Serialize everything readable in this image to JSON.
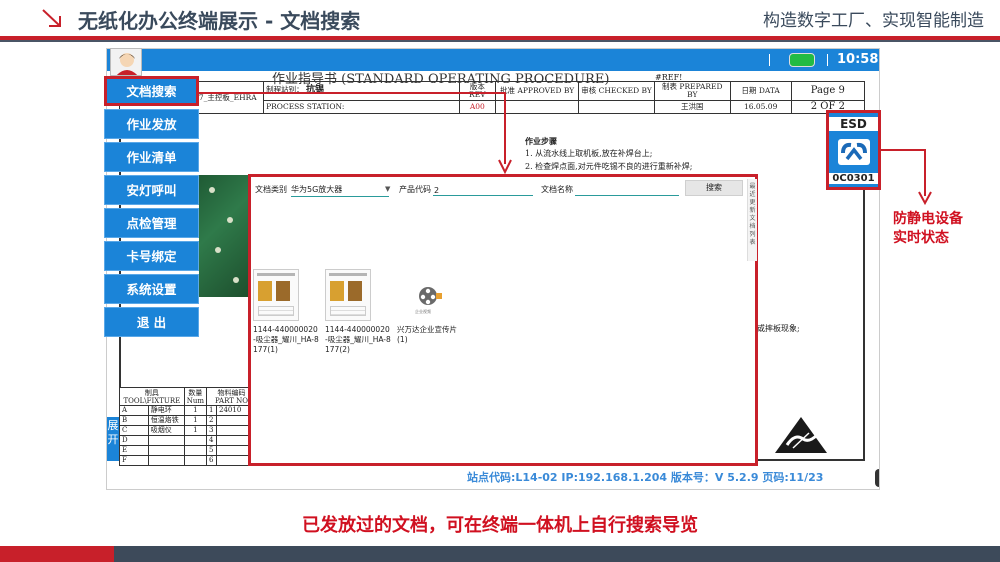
{
  "header": {
    "title": "无纸化办公终端展示 - 文档搜索",
    "slogan": "构造数字工厂、实现智能制造"
  },
  "topbar": {
    "time": "10:58"
  },
  "sop": {
    "title": "作业指导书 (STANDARD OPERATING PROCEDURE)",
    "ref": "#REF!",
    "product_cell": "吸尘器_耀川 HA-8177_主控板_EHRA",
    "process_station_label": "制程站别：",
    "process_station_value": "抗锡",
    "process_station_en": "PROCESS STATION:",
    "rev_label": "版本 REV",
    "rev_value": "A00",
    "approved_label": "批准 APPROVED BY",
    "checked_label": "审核 CHECKED BY",
    "prepared_label": "制表 PREPARED BY",
    "prepared_value": "王洪国",
    "date_label": "日期 DATA",
    "date_value": "16.05.09",
    "page_label": "Page",
    "page_value": "9",
    "page_of": "2  OF  2",
    "steps_title": "作业步骤",
    "step1": "1. 从流水线上取机板,放在补焊台上;",
    "step2": "2. 检查焊点面,对元件吃锡不良的进行重新补焊;",
    "defect_text": "或摔板现象;",
    "tools_header1": "制具 TOOL\\FIXTURE",
    "tools_header2": "数量 Num",
    "tools_header3": "物料编码 PART NO",
    "tools": [
      {
        "letter": "A",
        "name": "静电环",
        "num": "1",
        "idx": "1",
        "part": "24010"
      },
      {
        "letter": "B",
        "name": "恒温烙铁",
        "num": "1",
        "idx": "2",
        "part": ""
      },
      {
        "letter": "C",
        "name": "吸烟仪",
        "num": "1",
        "idx": "3",
        "part": ""
      },
      {
        "letter": "D",
        "name": "",
        "num": "",
        "idx": "4",
        "part": ""
      },
      {
        "letter": "E",
        "name": "",
        "num": "",
        "idx": "5",
        "part": ""
      },
      {
        "letter": "F",
        "name": "",
        "num": "",
        "idx": "6",
        "part": ""
      }
    ],
    "expand": "展开",
    "footer_info": "站点代码:L14-02    IP:192.168.1.204    版本号：V 5.2.9  页码:11/23"
  },
  "menu": [
    {
      "label": "文档搜索",
      "active": true
    },
    {
      "label": "作业发放"
    },
    {
      "label": "作业清单"
    },
    {
      "label": "安灯呼叫"
    },
    {
      "label": "点检管理"
    },
    {
      "label": "卡号绑定"
    },
    {
      "label": "系统设置"
    },
    {
      "label": "退 出"
    }
  ],
  "search": {
    "category_label": "文档类别",
    "category_value": "华为5G放大器",
    "product_code_label": "产品代码",
    "product_code_value": "2",
    "doc_name_label": "文档名称",
    "doc_name_value": "",
    "search_button": "搜索",
    "side_strip": "最近更新文档列表",
    "files": [
      {
        "name": "1144-440000020-吸尘器_耀川_HA-8177(1)"
      },
      {
        "name": "1144-440000020-吸尘器_耀川_HA-8177(2)"
      },
      {
        "name": "兴万达企业宣传片(1)"
      }
    ],
    "video_sub": "企业视频"
  },
  "esd": {
    "label": "ESD",
    "code": "0C0301"
  },
  "annotations": {
    "esd_line1": "防静电设备",
    "esd_line2": "实时状态",
    "caption": "已发放过的文档，可在终端一体机上自行搜索导览"
  },
  "colors": {
    "accent_red": "#c8202a",
    "primary_blue": "#1b84d8",
    "dark": "#3d4a5a"
  }
}
